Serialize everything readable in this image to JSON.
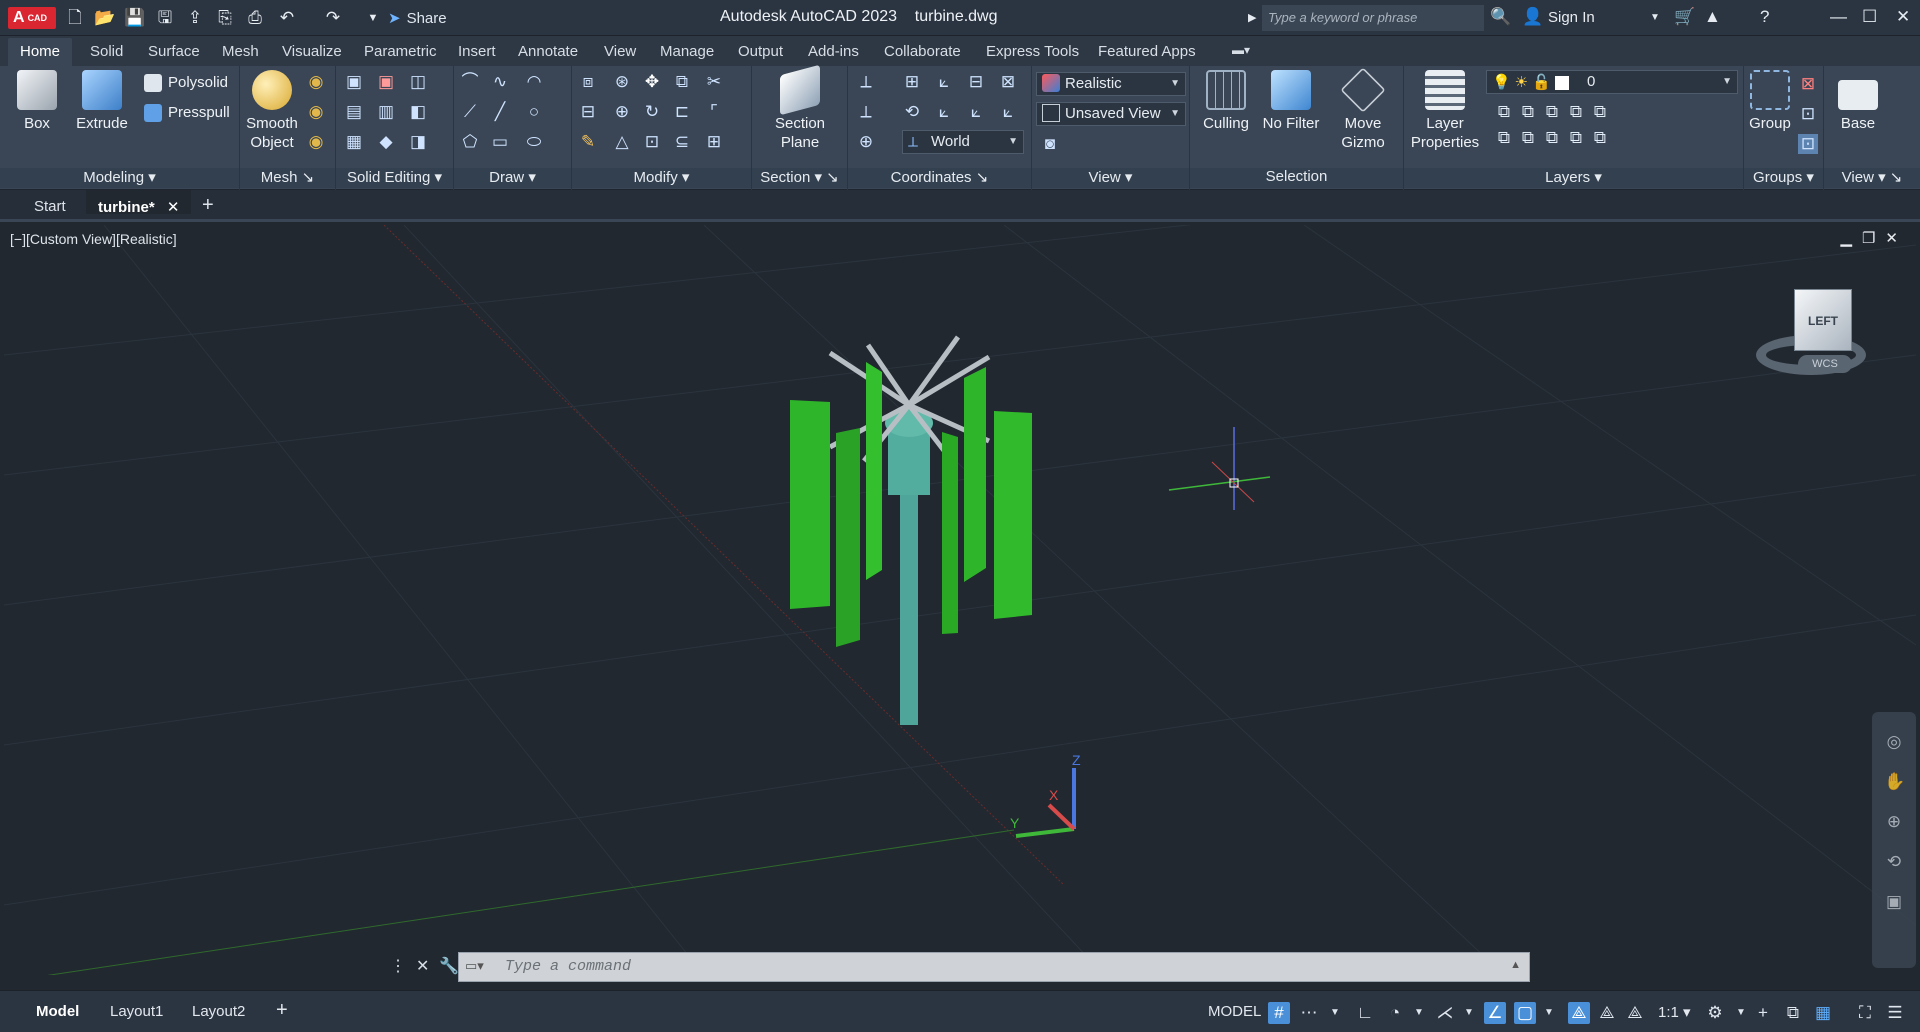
{
  "app": {
    "badge": "A",
    "badge_sub": "CAD",
    "title": "Autodesk AutoCAD 2023    turbine.dwg",
    "share": "Share",
    "search_placeholder": "Type a keyword or phrase",
    "sign_in": "Sign In"
  },
  "ribbon_tabs": [
    "Home",
    "Solid",
    "Surface",
    "Mesh",
    "Visualize",
    "Parametric",
    "Insert",
    "Annotate",
    "View",
    "Manage",
    "Output",
    "Add-ins",
    "Collaborate",
    "Express Tools",
    "Featured Apps"
  ],
  "panels": {
    "modeling": {
      "title": "Modeling",
      "box": "Box",
      "extrude": "Extrude",
      "polysolid": "Polysolid",
      "presspull": "Presspull"
    },
    "mesh": {
      "title": "Mesh",
      "smooth1": "Smooth",
      "smooth2": "Object"
    },
    "solid_editing": {
      "title": "Solid Editing"
    },
    "draw": {
      "title": "Draw"
    },
    "modify": {
      "title": "Modify"
    },
    "section": {
      "title": "Section",
      "plane1": "Section",
      "plane2": "Plane"
    },
    "coordinates": {
      "title": "Coordinates",
      "ucs": "World"
    },
    "view": {
      "title": "View",
      "visual_style": "Realistic",
      "named_view": "Unsaved View"
    },
    "selection": {
      "title": "Selection",
      "culling": "Culling",
      "nofilter": "No Filter",
      "gizmo1": "Move",
      "gizmo2": "Gizmo"
    },
    "layers": {
      "title": "Layers",
      "props1": "Layer",
      "props2": "Properties",
      "current_layer": "0"
    },
    "groups": {
      "title": "Groups",
      "group": "Group"
    },
    "viewpanel": {
      "title": "View",
      "base": "Base"
    }
  },
  "doc_tabs": {
    "start": "Start",
    "current": "turbine*"
  },
  "viewport": {
    "label": "[−][Custom View][Realistic]",
    "viewcube_face": "LEFT",
    "wcs": "WCS",
    "axis_x": "X",
    "axis_y": "Y",
    "axis_z": "Z"
  },
  "command": {
    "placeholder": "Type a command"
  },
  "layout_tabs": [
    "Model",
    "Layout1",
    "Layout2"
  ],
  "status": {
    "model": "MODEL",
    "scale": "1:1"
  },
  "colors": {
    "blade": "#2fb52a",
    "hub": "#4fa59a",
    "background": "#212830",
    "accent": "#4a90d9"
  }
}
